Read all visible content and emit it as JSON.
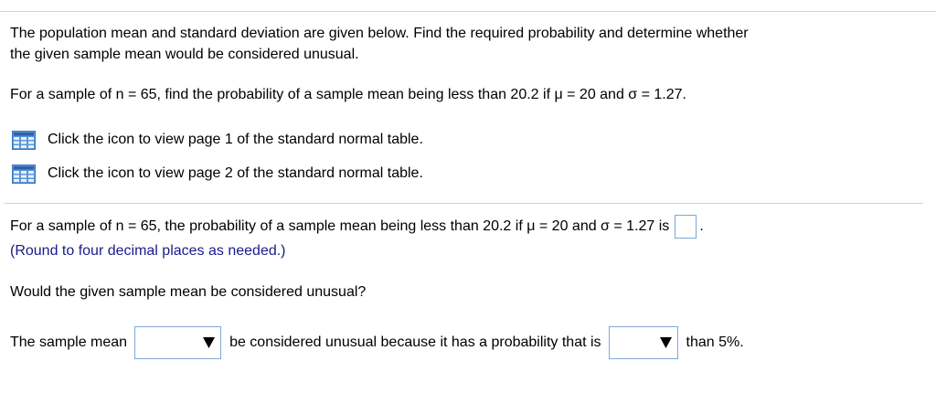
{
  "question": {
    "intro_line1": "The population mean and standard deviation are given below. Find the required probability and determine whether",
    "intro_line2": "the given sample mean would be considered unusual.",
    "given": "For a sample of n = 65, find the probability of a sample mean being less than 20.2 if μ = 20 and σ = 1.27."
  },
  "table_links": [
    {
      "label": "Click the icon to view page 1 of the standard normal table.",
      "icon": "table-icon"
    },
    {
      "label": "Click the icon to view page 2 of the standard normal table.",
      "icon": "table-icon"
    }
  ],
  "answer": {
    "prompt": "For a sample of n = 65, the probability of a sample mean being less than 20.2 if μ = 20 and σ = 1.27 is",
    "box_value": "",
    "period": ".",
    "hint": "(Round to four decimal places as needed.)"
  },
  "followup": {
    "question": "Would the given sample mean be considered unusual?",
    "part1": "The sample mean",
    "select1_value": "",
    "part2": "be considered unusual because it has a probability that is",
    "select2_value": "",
    "part3": "than 5%."
  },
  "colors": {
    "hint_text": "#1a1a8c",
    "input_border": "#7aa7d6",
    "icon_blue": "#3a78c4"
  }
}
